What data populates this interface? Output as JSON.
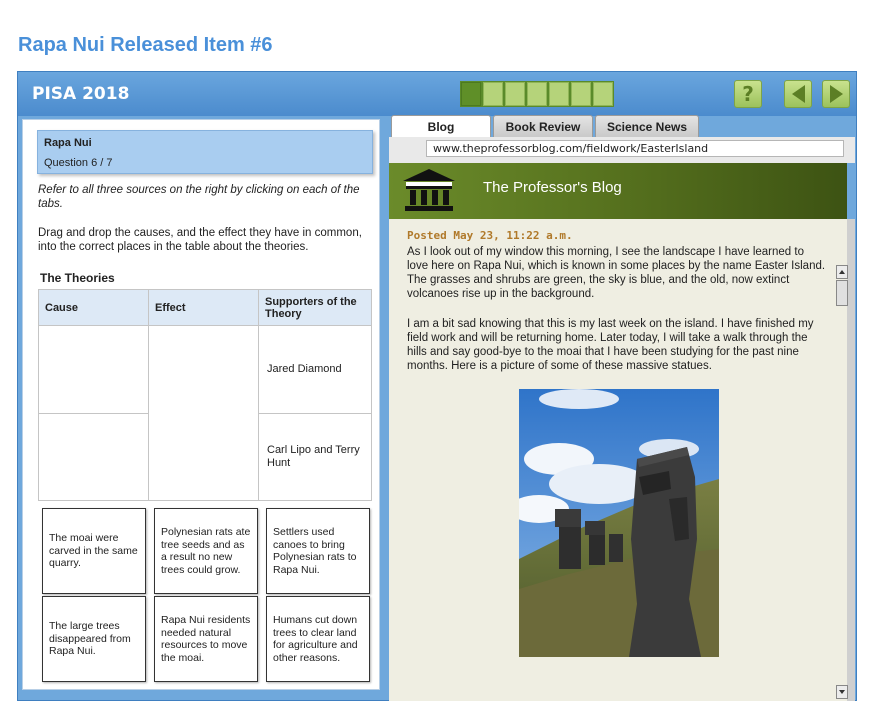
{
  "page": {
    "title": "Rapa Nui Released Item #6"
  },
  "header": {
    "brand": "PISA 2018",
    "progress": {
      "total": 7,
      "current": 1
    },
    "help_icon": "question-mark-icon",
    "help_label": "?",
    "prev_icon": "arrow-left-icon",
    "next_icon": "arrow-right-icon"
  },
  "question": {
    "unit": "Rapa Nui",
    "number": "Question 6 / 7",
    "instruction1": "Refer to all three sources on the right by clicking on each of the tabs.",
    "instruction2": "Drag and drop the causes, and the effect they have in common, into the correct places in the table about the theories.",
    "table_title": "The Theories",
    "columns": [
      "Cause",
      "Effect",
      "Supporters of the Theory"
    ],
    "supporters": [
      "Jared Diamond",
      "Carl Lipo and Terry Hunt"
    ]
  },
  "cards": [
    "The moai were carved in the same quarry.",
    "Polynesian rats ate tree seeds and as a result no new trees could grow.",
    "Settlers used canoes to bring Polynesian rats to Rapa Nui.",
    "The large trees disappeared from Rapa Nui.",
    "Rapa Nui residents needed natural resources to move the moai.",
    "Humans cut down trees to clear land for agriculture and other reasons."
  ],
  "tabs": [
    "Blog",
    "Book Review",
    "Science News"
  ],
  "active_tab": "Blog",
  "browser": {
    "url": "www.theprofessorblog.com/fieldwork/EasterIsland"
  },
  "blog": {
    "icon": "building-columns-icon",
    "title": "The Professor's Blog",
    "posted": "Posted May 23, 11:22 a.m.",
    "paragraph1": "As I look out of my window this morning, I see the landscape I have learned to love here on Rapa Nui, which is known in some places by the name Easter Island. The grasses and shrubs are green, the sky is blue, and the old, now extinct volcanoes rise up in the background.",
    "paragraph2": "I am a bit sad knowing that this is my last week on the island. I have finished my field work and will be returning home. Later today, I will take a walk through the hills and say good-bye to the moai that I have been studying for the past nine months. Here is a picture of some of these massive statues."
  },
  "colors": {
    "accent": "#4a90d9",
    "frame": "#6fa8dc",
    "blog_header": "#56711e",
    "posted": "#b0792a",
    "nav_button": "#9cc25c"
  }
}
